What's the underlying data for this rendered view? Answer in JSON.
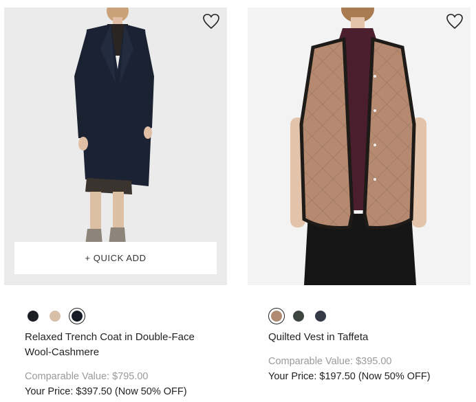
{
  "products": [
    {
      "name": "Relaxed Trench Coat in Double-Face Wool-Cashmere",
      "quick_add_label": "+ QUICK ADD",
      "comparable": "Comparable Value: $795.00",
      "your_price": "Your Price: $397.50 (Now 50% OFF)",
      "swatches": [
        {
          "color": "#1b1f25",
          "selected": false
        },
        {
          "color": "#d8bfa9",
          "selected": false
        },
        {
          "color": "#161b25",
          "selected": true
        }
      ]
    },
    {
      "name": "Quilted Vest in Taffeta",
      "comparable": "Comparable Value: $395.00",
      "your_price": "Your Price: $197.50 (Now 50% OFF)",
      "swatches": [
        {
          "color": "#b08a73",
          "selected": true
        },
        {
          "color": "#3d4540",
          "selected": false
        },
        {
          "color": "#353b44",
          "selected": false
        }
      ]
    }
  ],
  "icons": {
    "wishlist": "heart-outline-icon"
  }
}
